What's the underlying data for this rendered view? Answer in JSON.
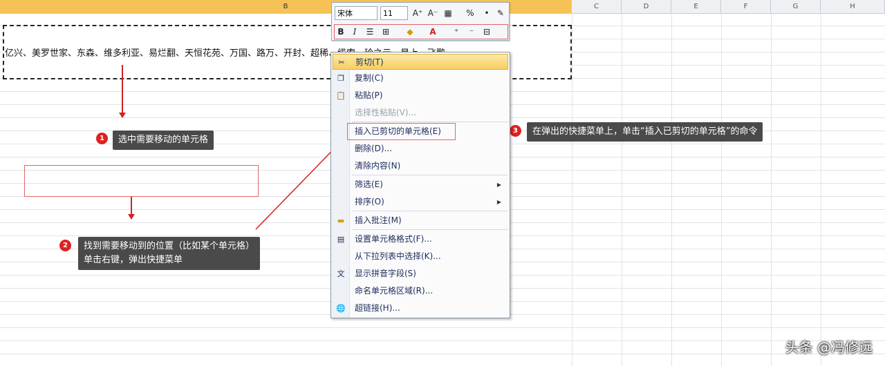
{
  "columns": [
    {
      "label": "B",
      "selected": true
    },
    {
      "label": "C",
      "selected": false
    },
    {
      "label": "D",
      "selected": false
    },
    {
      "label": "E",
      "selected": false
    },
    {
      "label": "F",
      "selected": false
    },
    {
      "label": "G",
      "selected": false
    },
    {
      "label": "H",
      "selected": false
    }
  ],
  "cell": {
    "text": "亿兴、美罗世家、东森、维多利亚、易烂翻、天恒花苑、万国、路万、开封、超稀、缆索、玲之云、星上、飞鹏"
  },
  "mini_toolbar": {
    "font_name": "宋体",
    "font_size": "11",
    "bold": "B",
    "italic": "I",
    "percent": "%",
    "grow_font": "A⁺",
    "shrink_font": "A⁻"
  },
  "context_menu": {
    "items": [
      {
        "label": "剪切(T)",
        "icon": "scissors-icon",
        "state": "hover"
      },
      {
        "label": "复制(C)",
        "icon": "copy-icon",
        "state": "normal"
      },
      {
        "label": "粘贴(P)",
        "icon": "paste-icon",
        "state": "normal"
      },
      {
        "label": "选择性粘贴(V)...",
        "icon": "",
        "state": "disabled"
      },
      {
        "label": "插入已剪切的单元格(E)",
        "icon": "",
        "state": "normal"
      },
      {
        "label": "删除(D)...",
        "icon": "",
        "state": "normal"
      },
      {
        "label": "清除内容(N)",
        "icon": "",
        "state": "normal"
      },
      {
        "label": "筛选(E)",
        "icon": "",
        "state": "normal",
        "submenu": "▶"
      },
      {
        "label": "排序(O)",
        "icon": "",
        "state": "normal",
        "submenu": "▶"
      },
      {
        "label": "插入批注(M)",
        "icon": "comment-icon",
        "state": "normal"
      },
      {
        "label": "设置单元格格式(F)...",
        "icon": "format-cells-icon",
        "state": "normal"
      },
      {
        "label": "从下拉列表中选择(K)...",
        "icon": "",
        "state": "normal"
      },
      {
        "label": "显示拼音字段(S)",
        "icon": "phonetic-icon",
        "state": "normal"
      },
      {
        "label": "命名单元格区域(R)...",
        "icon": "",
        "state": "normal"
      },
      {
        "label": "超链接(H)...",
        "icon": "hyperlink-icon",
        "state": "normal"
      }
    ]
  },
  "callouts": {
    "step1": {
      "num": "1",
      "text": "选中需要移动的单元格"
    },
    "step2": {
      "num": "2",
      "line1": "找到需要移动到的位置（比如某个单元格）",
      "line2": "单击右键，弹出快捷菜单"
    },
    "step3": {
      "num": "3",
      "text": "在弹出的快捷菜单上，单击“插入已剪切的单元格”的命令"
    }
  },
  "watermark": "头条 @冯修远",
  "colors": {
    "accent": "#f6c255",
    "annotation": "#d32020",
    "callout_bg": "#4a4a4a"
  }
}
